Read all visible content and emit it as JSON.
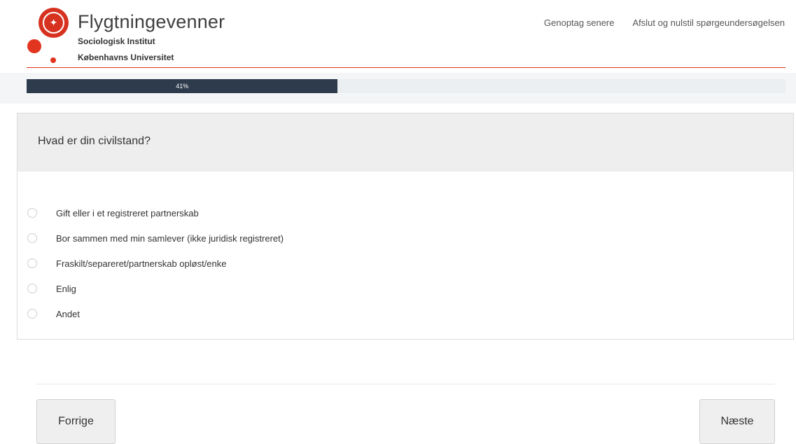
{
  "header": {
    "brand": "Flygtningevenner",
    "sub1": "Sociologisk Institut",
    "sub2": "Københavns Universitet",
    "links": [
      "Genoptag senere",
      "Afslut og nulstil spørgeundersøgelsen"
    ]
  },
  "progress": {
    "value": 0.41,
    "label": "41%"
  },
  "question": {
    "text": "Hvad er din civilstand?",
    "options": [
      "Gift eller i et registreret partnerskab",
      "Bor sammen med min samlever (ikke juridisk registreret)",
      "Fraskilt/separeret/partnerskab opløst/enke",
      "Enlig",
      "Andet"
    ]
  },
  "nav": {
    "prev": "Forrige",
    "next": "Næste"
  },
  "colors": {
    "accent": "#e1351f",
    "progress": "#2d3b4d"
  }
}
